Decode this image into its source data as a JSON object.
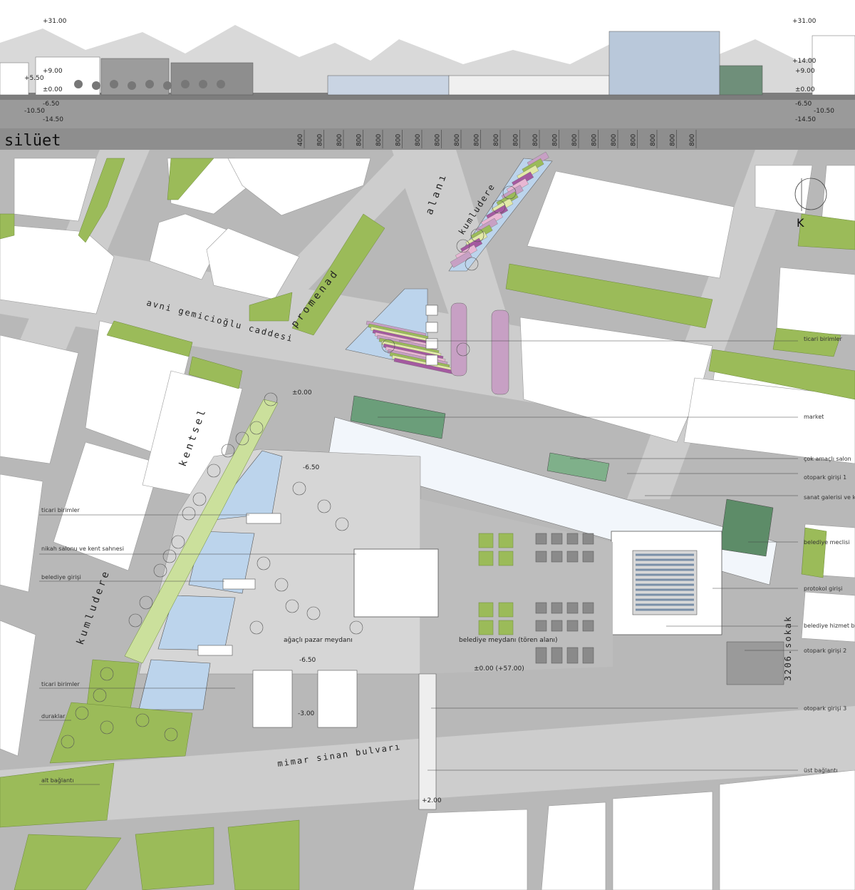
{
  "silhouette": {
    "title": "silüet",
    "levels_left": [
      "+31.00",
      "+9.00",
      "+5.50",
      "±0.00",
      "-6.50",
      "-10.50",
      "-14.50"
    ],
    "levels_right": [
      "+31.00",
      "+14.00",
      "+9.00",
      "±0.00",
      "-6.50",
      "-10.50",
      "-14.50"
    ],
    "spacings": [
      "400",
      "800",
      "800",
      "800",
      "800",
      "800",
      "800",
      "800",
      "800",
      "800",
      "800",
      "800",
      "800",
      "800",
      "800",
      "800",
      "800",
      "800",
      "800",
      "800",
      "800"
    ]
  },
  "streets": {
    "avni": "avni gemicioğlu caddesi",
    "promenad": "promenad",
    "alani": "alanı",
    "kumludere_top": "kumludere",
    "kentsel": "kentsel",
    "kumludere_left": "kumludere",
    "mimar": "mimar sinan bulvarı",
    "sokak": "3206.sokak"
  },
  "north_mark": "K",
  "levels": {
    "street": "±0.00",
    "pool": "-6.50",
    "square_low": "-6.50",
    "lower": "-3.00",
    "square": "±0.00 (+57.00)",
    "bridge": "+2.00"
  },
  "squares": {
    "market": "ağaçlı pazar meydanı",
    "ceremony": "belediye meydanı (tören alanı)"
  },
  "labels_right": [
    "ticari birimler",
    "market",
    "çok amaçlı salon",
    "otopark girişi 1",
    "sanat galerisi ve kitaplık",
    "belediye meclisi",
    "protokol girişi",
    "belediye hizmet binası",
    "otopark girişi 2",
    "otopark girişi 3",
    "üst bağlantı"
  ],
  "labels_left": [
    "ticari birimler",
    "nikah salonu ve kent sahnesi",
    "belediye girişi",
    "ticari birimler",
    "duraklar",
    "alt bağlantı"
  ],
  "colors": {
    "bg": "#b8b8b8",
    "road": "#c9c9c9",
    "block": "#ffffff",
    "green": "#9bbb59",
    "water": "#bcd4ec",
    "band": "#8e8e8e",
    "accent_green": "#6b9e7a"
  }
}
